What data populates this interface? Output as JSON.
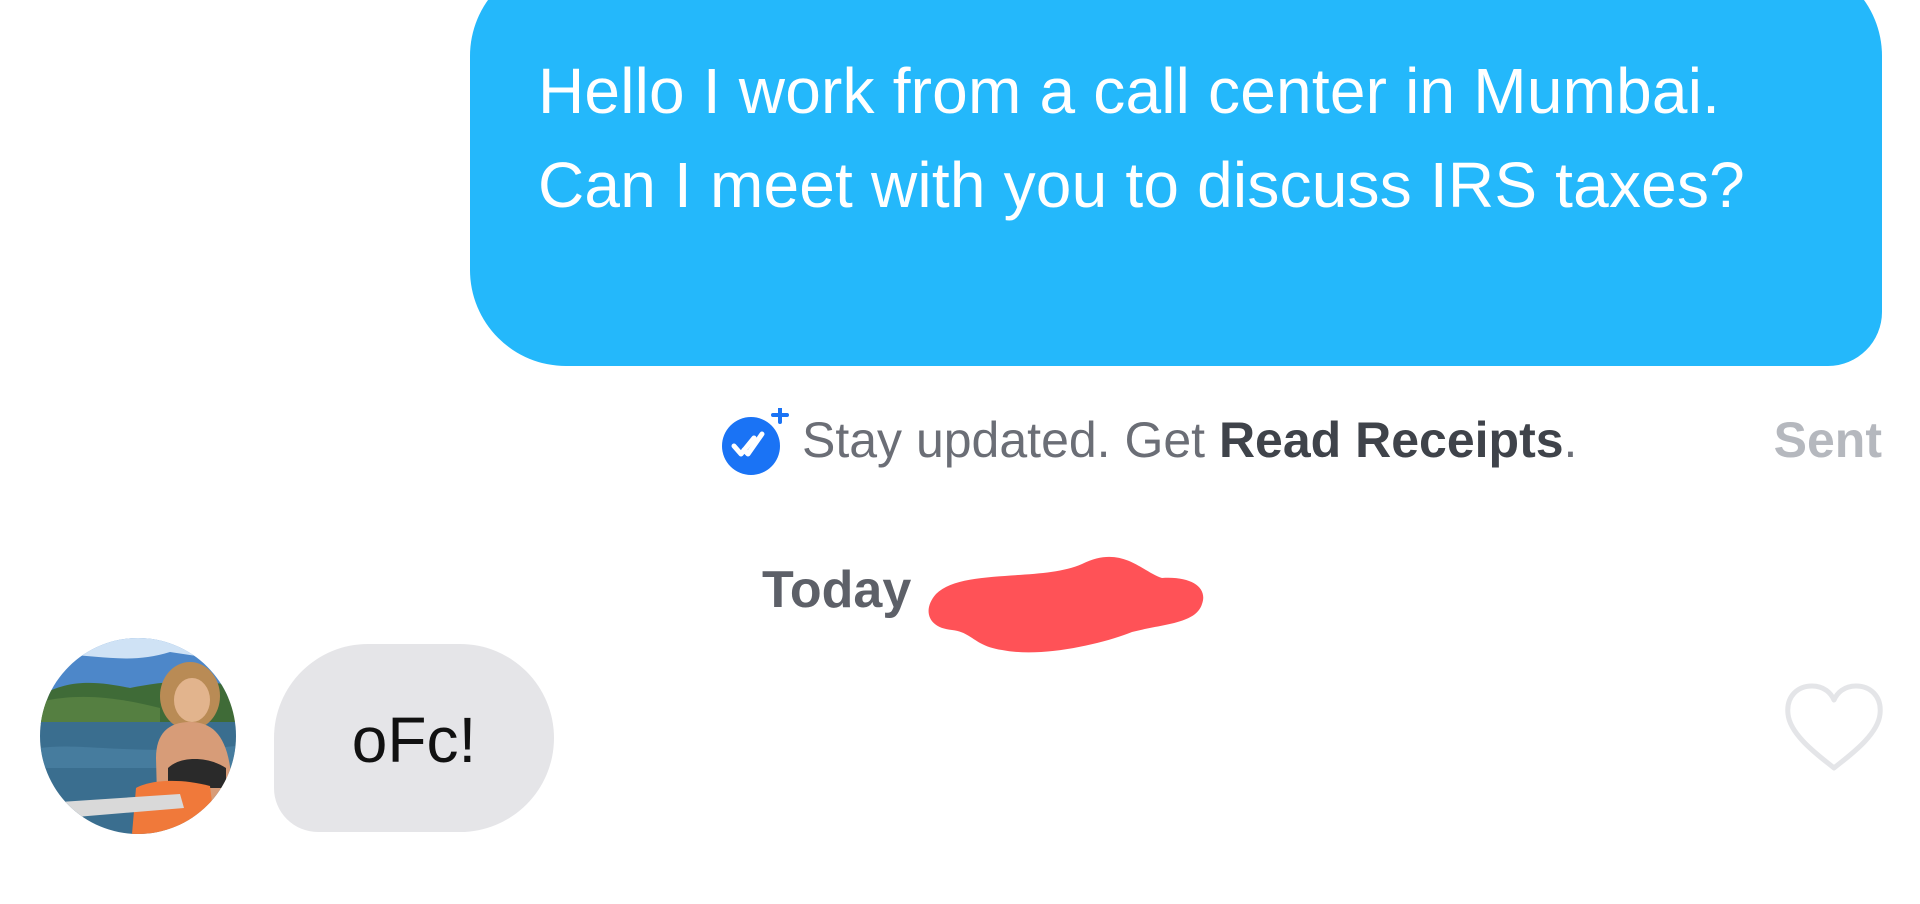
{
  "outgoing_message": {
    "text": "Hello I work from a call center in Mumbai. Can I meet with you to discuss IRS taxes?",
    "bubble_color": "#24b8fb"
  },
  "read_receipt_prompt": {
    "prefix": "Stay updated. Get ",
    "link": "Read Receipts",
    "suffix": ".",
    "icon": "double-check-plus-icon",
    "icon_color": "#1a73f5"
  },
  "status": {
    "label": "Sent"
  },
  "date_separator": {
    "label": "Today",
    "redaction_color": "#ff5257"
  },
  "incoming_message": {
    "text": "oFc!",
    "bubble_color": "#e5e5e8",
    "avatar": "avatar-photo"
  },
  "like_button": {
    "icon": "heart-outline-icon"
  }
}
